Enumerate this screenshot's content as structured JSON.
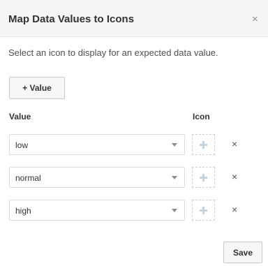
{
  "dialog": {
    "title": "Map Data Values to Icons",
    "close_label": "×",
    "description": "Select an icon to display for an expected data value.",
    "add_button_label": "+ Value",
    "columns": {
      "value": "Value",
      "icon": "Icon"
    },
    "rows": [
      {
        "value": "low"
      },
      {
        "value": "normal"
      },
      {
        "value": "high"
      }
    ],
    "delete_label": "×",
    "save_button_label": "Save"
  },
  "icons": {
    "close": "close-icon",
    "dropdown": "chevron-down-icon",
    "add_icon": "plus-icon",
    "delete": "close-icon"
  },
  "colors": {
    "header_bg": "#f5f5f5",
    "button_bg": "#f7f7f7",
    "plus_icon": "#c6d2dd"
  }
}
